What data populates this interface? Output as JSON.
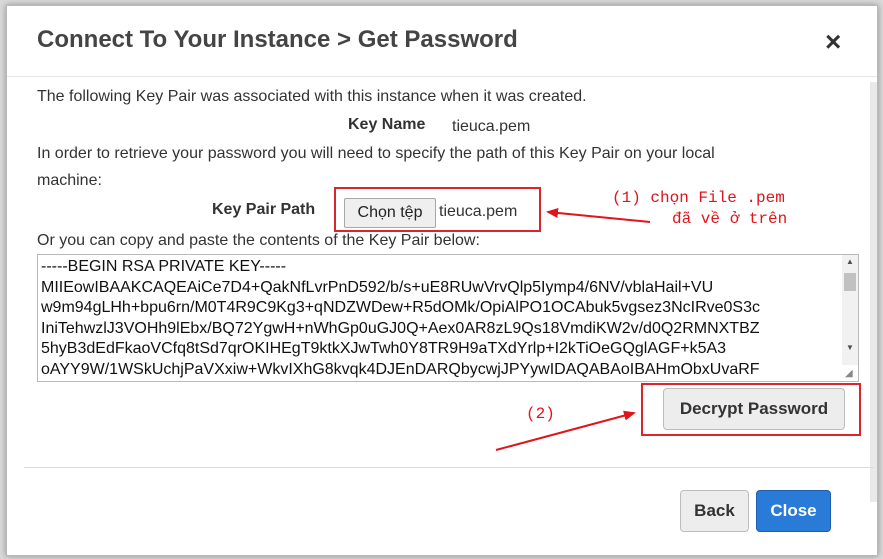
{
  "dialog": {
    "title": "Connect To Your Instance > Get Password",
    "close_symbol": "×",
    "intro_text": "The following Key Pair was associated with this instance when it was created.",
    "key_name_label": "Key Name",
    "key_name_value": "tieuca.pem",
    "retrieve_text_line1": "In order to retrieve your password you will need to specify the path of this Key Pair on your local",
    "retrieve_text_line2": "machine:",
    "key_pair_path_label": "Key Pair Path",
    "choose_file_label": "Chọn tệp",
    "chosen_file_name": "tieuca.pem",
    "paste_text": "Or you can copy and paste the contents of the Key Pair below:",
    "key_contents": "-----BEGIN RSA PRIVATE KEY-----\nMIIEowIBAAKCAQEAiCe7D4+QakNfLvrPnD592/b/s+uE8RUwVrvQlp5Iymp4/6NV/vblaHail+VU\nw9m94gLHh+bpu6rn/M0T4R9C9Kg3+qNDZWDew+R5dOMk/OpiAlPO1OCAbuk5vgsez3NcIRve0S3c\nIniTehwzlJ3VOHh9lEbx/BQ72YgwH+nWhGp0uGJ0Q+Aex0AR8zL9Qs18VmdiKW2v/d0Q2RMNXTBZ\n5hyB3dEdFkaoVCfq8tSd7qrOKIHEgT9ktkXJwTwh0Y8TR9H9aTXdYrlp+I2kTiOeGQglAGF+k5A3\noAYY9W/1WSkUchjPaVXxiw+WkvIXhG8kvqk4DJEnDARQbycwjJPYywIDAQABAoIBAHmObxUvaRF",
    "decrypt_label": "Decrypt Password",
    "back_label": "Back",
    "close_label": "Close"
  },
  "annotations": {
    "note1_line1": "(1)  chọn File .pem",
    "note1_line2": "đã về ở trên",
    "note2": "(2)",
    "color": "#e0141b"
  },
  "colors": {
    "primary_button": "#2a7bd8",
    "annotation_red": "#d9252b"
  }
}
